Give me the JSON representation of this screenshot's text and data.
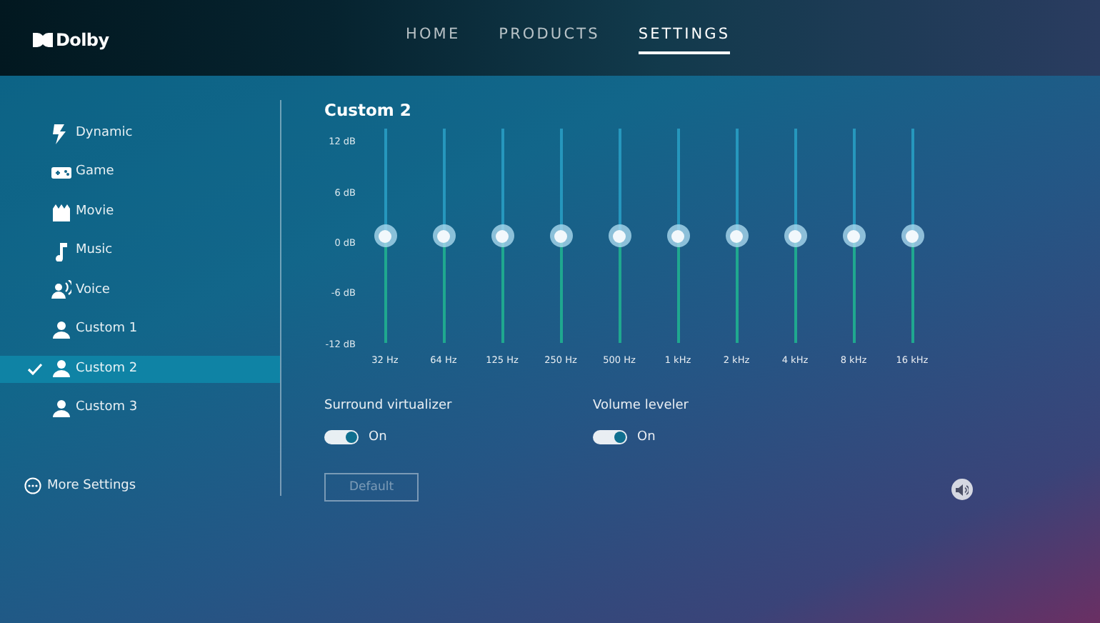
{
  "header": {
    "logo": "Dolby",
    "nav": [
      {
        "label": "HOME",
        "selected": false
      },
      {
        "label": "PRODUCTS",
        "selected": false
      },
      {
        "label": "SETTINGS",
        "selected": true
      }
    ]
  },
  "sidebar": {
    "items": [
      {
        "kind": "bolt",
        "label": "Dynamic",
        "selected": false
      },
      {
        "kind": "gamepad",
        "label": "Game",
        "selected": false
      },
      {
        "kind": "film",
        "label": "Movie",
        "selected": false
      },
      {
        "kind": "note",
        "label": "Music",
        "selected": false
      },
      {
        "kind": "voice",
        "label": "Voice",
        "selected": false
      },
      {
        "kind": "person",
        "label": "Custom 1",
        "selected": false
      },
      {
        "kind": "person",
        "label": "Custom 2",
        "selected": true
      },
      {
        "kind": "person",
        "label": "Custom 3",
        "selected": false
      }
    ],
    "more": "More Settings"
  },
  "equalizer": {
    "title": "Custom 2",
    "scale": [
      "12 dB",
      "6 dB",
      "0 dB",
      "-6 dB",
      "-12 dB"
    ],
    "bands": [
      {
        "label": "32 Hz",
        "level": 0.5
      },
      {
        "label": "64 Hz",
        "level": 0.5
      },
      {
        "label": "125 Hz",
        "level": 0.5
      },
      {
        "label": "250 Hz",
        "level": 0.5
      },
      {
        "label": "500 Hz",
        "level": 0.5
      },
      {
        "label": "1 kHz",
        "level": 0.5
      },
      {
        "label": "2 kHz",
        "level": 0.5
      },
      {
        "label": "4 kHz",
        "level": 0.5
      },
      {
        "label": "8 kHz",
        "level": 0.5
      },
      {
        "label": "16 kHz",
        "level": 0.5
      }
    ]
  },
  "toggles": [
    {
      "label": "Surround virtualizer",
      "on": true,
      "state": "On"
    },
    {
      "label": "Volume leveler",
      "on": true,
      "state": "On"
    }
  ],
  "default_button": {
    "label": "Default",
    "disabled": true
  }
}
